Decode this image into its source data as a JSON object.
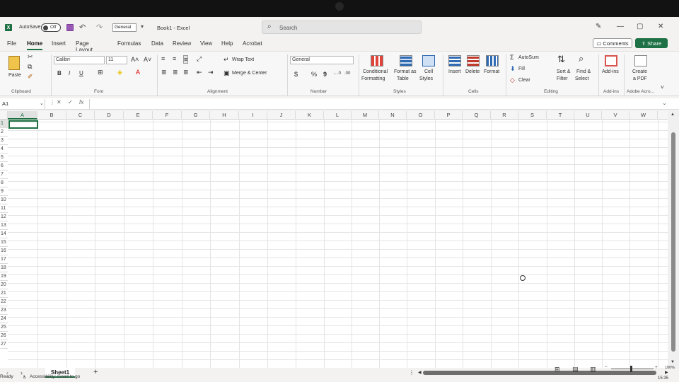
{
  "title_bar": {
    "autosave_label": "AutoSave",
    "autosave_state": "Off",
    "qat_dropdown": "General",
    "doc_title": "Book1  -  Excel",
    "search_placeholder": "Search",
    "minimize": "—",
    "restore": "▢",
    "close": "✕"
  },
  "tabs": [
    "File",
    "Home",
    "Insert",
    "Page Layout",
    "Formulas",
    "Data",
    "Review",
    "View",
    "Help",
    "Acrobat"
  ],
  "active_tab": "Home",
  "comments_label": "Comments",
  "share_label": "Share",
  "ribbon": {
    "clipboard": {
      "paste": "Paste",
      "label": "Clipboard"
    },
    "font": {
      "family": "Calibri",
      "size": "11",
      "bold": "B",
      "italic": "I",
      "underline": "U",
      "label": "Font"
    },
    "alignment": {
      "wrap": "Wrap Text",
      "merge": "Merge & Center",
      "label": "Alignment"
    },
    "number": {
      "format": "General",
      "currency": "$",
      "percent": "%",
      "comma": "9",
      "inc": "←.0",
      "dec": ".00",
      "label": "Number"
    },
    "styles": {
      "cond1": "Conditional",
      "cond2": "Formatting",
      "fat1": "Format as",
      "fat2": "Table",
      "cs1": "Cell",
      "cs2": "Styles",
      "label": "Styles"
    },
    "cells": {
      "insert": "Insert",
      "delete": "Delete",
      "format": "Format",
      "label": "Cells"
    },
    "editing": {
      "autosum": "AutoSum",
      "fill": "Fill",
      "clear": "Clear",
      "sort1": "Sort &",
      "sort2": "Filter",
      "find1": "Find &",
      "find2": "Select",
      "label": "Editing"
    },
    "addins": {
      "btn": "Add-ins",
      "label": "Add-ins"
    },
    "adobe": {
      "l1": "Create",
      "l2": "a PDF",
      "label": "Adobe Acro..."
    }
  },
  "formula_bar": {
    "name_box": "A1",
    "fx": "fx"
  },
  "columns": [
    "A",
    "B",
    "C",
    "D",
    "E",
    "F",
    "G",
    "H",
    "I",
    "J",
    "K",
    "L",
    "M",
    "N",
    "O",
    "P",
    "Q",
    "R",
    "S",
    "T",
    "U",
    "V",
    "W"
  ],
  "rows": [
    "1",
    "2",
    "3",
    "4",
    "5",
    "6",
    "7",
    "8",
    "9",
    "10",
    "11",
    "12",
    "13",
    "14",
    "15",
    "16",
    "17",
    "18",
    "19",
    "20",
    "21",
    "22",
    "23",
    "24",
    "25",
    "26",
    "27"
  ],
  "sheet_tab": "Sheet1",
  "add_sheet": "+",
  "status": {
    "ready": "Ready",
    "accessibility": "Accessibility: Good to go",
    "zoom": "100%",
    "time": "15:35"
  }
}
